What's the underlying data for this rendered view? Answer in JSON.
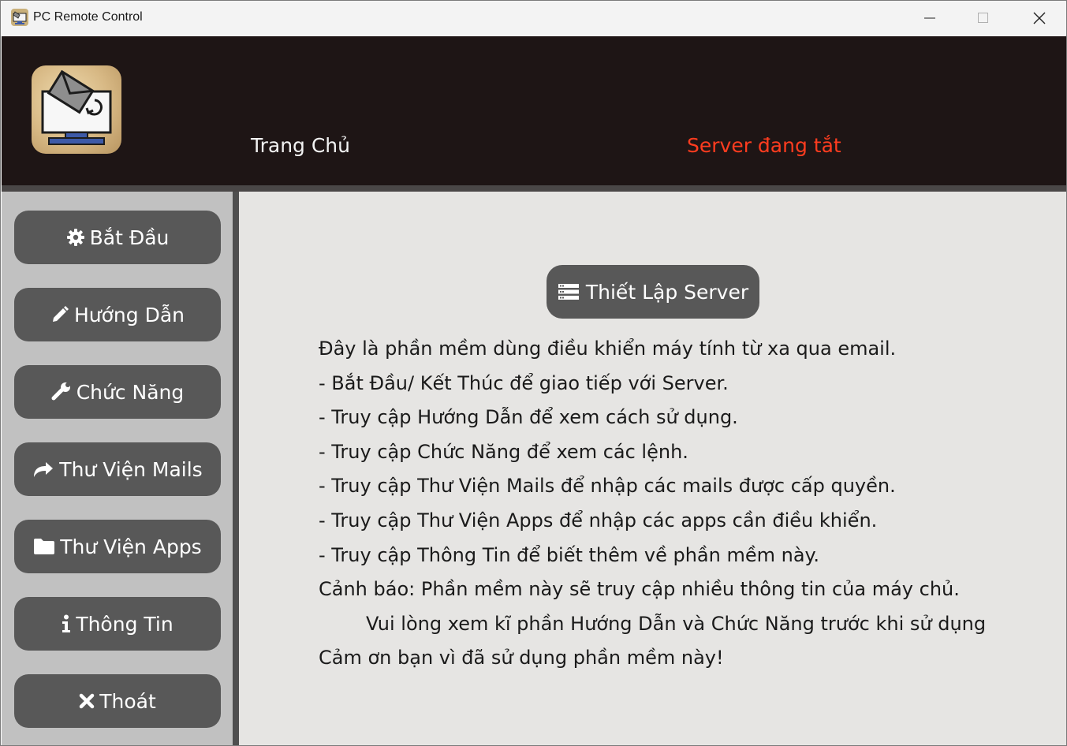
{
  "window": {
    "title": "PC Remote Control"
  },
  "header": {
    "title": "Trang Chủ",
    "server_status": "Server đang tắt",
    "server_status_color": "#ff3c1f"
  },
  "sidebar": {
    "items": [
      {
        "label": "Bắt Đầu",
        "icon": "gear-icon"
      },
      {
        "label": "Hướng Dẫn",
        "icon": "pencil-icon"
      },
      {
        "label": "Chức Năng",
        "icon": "wrench-icon"
      },
      {
        "label": "Thư Viện Mails",
        "icon": "share-arrow-icon"
      },
      {
        "label": "Thư Viện Apps",
        "icon": "folder-icon"
      },
      {
        "label": "Thông Tin",
        "icon": "info-icon"
      },
      {
        "label": "Thoát",
        "icon": "close-x-icon"
      }
    ]
  },
  "main": {
    "setup_button": {
      "label": "Thiết Lập Server",
      "icon": "server-icon"
    },
    "description": [
      "Đây là phần mềm dùng điều khiển máy tính từ xa qua email.",
      "- Bắt Đầu/ Kết Thúc để giao tiếp với Server.",
      "- Truy cập Hướng Dẫn để xem cách sử dụng.",
      "- Truy cập Chức Năng để xem các lệnh.",
      "- Truy cập Thư Viện Mails để nhập các mails được cấp quyền.",
      "- Truy cập Thư Viện Apps để nhập các apps cần điều khiển.",
      "- Truy cập Thông Tin để biết thêm về phần mềm này.",
      "Cảnh báo: Phần mềm này sẽ truy cập nhiều thông tin của máy chủ.",
      "Vui lòng xem kĩ phần Hướng Dẫn và Chức Năng trước khi sử dụng",
      "Cảm ơn bạn vì đã sử dụng phần mềm này!"
    ]
  }
}
